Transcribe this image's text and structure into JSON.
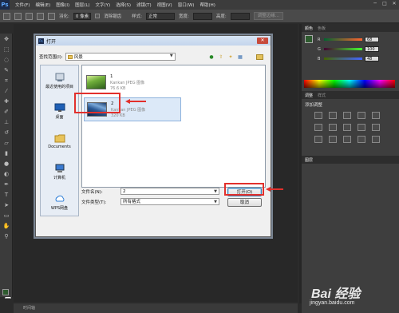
{
  "app": {
    "logo": "Ps",
    "menus": [
      "文件(F)",
      "编辑(E)",
      "图像(I)",
      "图层(L)",
      "文字(Y)",
      "选择(S)",
      "滤镜(T)",
      "视图(V)",
      "窗口(W)",
      "帮助(H)"
    ],
    "window_controls": [
      "─",
      "□",
      "✕"
    ]
  },
  "options": {
    "feather_label": "羽化:",
    "feather_value": "0 像素",
    "antialias_label": "消除锯齿",
    "style_label": "样式:",
    "style_value": "正常",
    "width_label": "宽度:",
    "height_label": "高度:",
    "refine_button": "调整边缘..."
  },
  "status": {
    "text": "时间轴"
  },
  "color_panel": {
    "tabs": [
      "颜色",
      "色板"
    ],
    "sliders": [
      {
        "label": "R",
        "value": "68"
      },
      {
        "label": "G",
        "value": "100"
      },
      {
        "label": "B",
        "value": "48"
      }
    ]
  },
  "adjust_panel": {
    "tabs": [
      "调整",
      "样式"
    ],
    "title": "添加调整"
  },
  "layers_panel": {
    "tabs": [
      "图层"
    ]
  },
  "dialog": {
    "title": "打开",
    "close": "✕",
    "look_in_label": "查找范围(I):",
    "look_in_value": "风景",
    "places": [
      {
        "label": "最近使用的项目",
        "icon": "recent-icon"
      },
      {
        "label": "桌面",
        "icon": "desktop-icon"
      },
      {
        "label": "Documents",
        "icon": "documents-folder-icon"
      },
      {
        "label": "计算机",
        "icon": "computer-icon"
      },
      {
        "label": "WPS网盘",
        "icon": "cloud-icon"
      }
    ],
    "files": [
      {
        "name": "1",
        "type": "Kankan JPEG 图像",
        "size": "76.6 KB"
      },
      {
        "name": "2",
        "type": "Kankan JPEG 图像",
        "size": "320 KB"
      }
    ],
    "filename_label": "文件名(N):",
    "filename_value": "2",
    "filetype_label": "文件类型(T):",
    "filetype_value": "所有格式",
    "open_button": "打开(O)",
    "cancel_button": "取消"
  },
  "watermark": {
    "main": "Bai 经验",
    "sub": "jingyan.baidu.com"
  },
  "colors": {
    "highlight_red": "#e2302c",
    "foreground_swatch": "#2e5b2f"
  }
}
